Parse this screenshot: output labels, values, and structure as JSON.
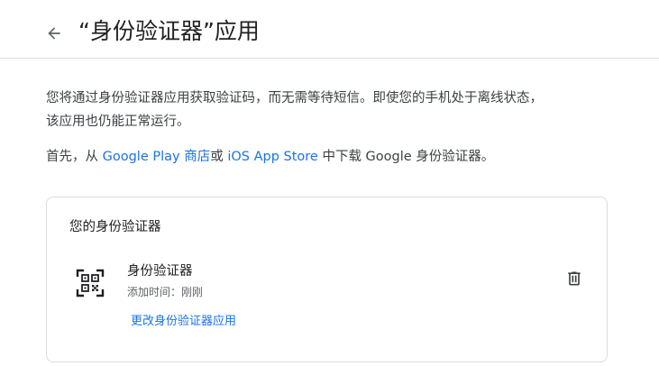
{
  "header": {
    "back_icon": "arrow-left-icon",
    "title": "“身份验证器”应用"
  },
  "description": "您将通过身份验证器应用获取验证码，而无需等待短信。即使您的手机处于离线状态，该应用也仍能正常运行。",
  "download": {
    "prefix": "首先，从 ",
    "play_link": "Google Play 商店",
    "or": "或 ",
    "ios_link": "iOS App Store",
    "suffix": " 中下载 Google 身份验证器。"
  },
  "card": {
    "title": "您的身份验证器",
    "authenticator": {
      "icon": "qr-code-icon",
      "name": "身份验证器",
      "added_time": "添加时间：刚刚"
    },
    "change_link": "更改身份验证器应用",
    "delete_icon": "trash-icon"
  },
  "colors": {
    "link": "#1a73e8",
    "text": "#202124",
    "secondary_text": "#5f6368",
    "divider": "#dadce0"
  }
}
